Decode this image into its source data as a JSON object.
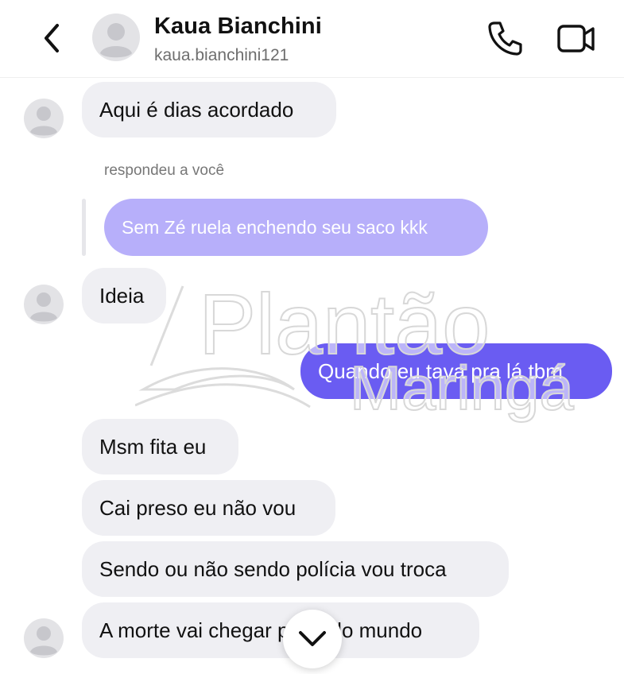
{
  "header": {
    "name": "Kaua Bianchini",
    "handle": "kaua.bianchini121",
    "icons": [
      "back-arrow-icon",
      "avatar-placeholder",
      "phone-icon",
      "video-camera-icon"
    ]
  },
  "messages": [
    {
      "side": "in",
      "text": "Aqui é dias acordado"
    },
    {
      "side": "reply",
      "label": "respondeu a você",
      "quoted": "Sem Zé ruela enchendo seu saco kkk"
    },
    {
      "side": "in",
      "text": "Ideia"
    },
    {
      "side": "out",
      "text": "Quando eu tava pra lá tbm"
    },
    {
      "side": "in",
      "text": "Msm fita eu"
    },
    {
      "side": "in",
      "text": "Cai preso eu não vou"
    },
    {
      "side": "in",
      "text": "Sendo ou não sendo polícia vou troca"
    },
    {
      "side": "in",
      "text": "A morte vai chegar pra todo mundo"
    }
  ],
  "watermark": {
    "line1": "Plantão",
    "line2": "Maringá"
  },
  "colors": {
    "outgoing": "#6a5cf2",
    "reply_preview": "#b7affa",
    "incoming": "#efeff3"
  }
}
